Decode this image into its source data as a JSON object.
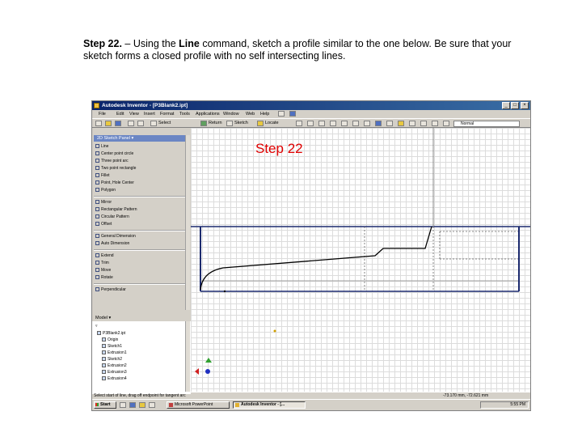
{
  "instruction": {
    "step_label": "Step 22.",
    "dash": "– Using the",
    "command": "Line",
    "text": "command, sketch a profile similar to the one below. Be sure that your sketch forms a closed profile with no self intersecting lines."
  },
  "window": {
    "title": "Autodesk Inventor - [P3Blank2.ipt]",
    "buttons": [
      "_",
      "□",
      "×"
    ]
  },
  "menu": [
    "File",
    "Edit",
    "View",
    "Insert",
    "Format",
    "Tools",
    "Applications",
    "Window",
    "Web",
    "Help"
  ],
  "toolbar": {
    "select": "Select",
    "return": "Return",
    "sketch": "Sketch",
    "locate": "Locate",
    "style": "Normal"
  },
  "sketch_panel": {
    "header": "2D Sketch Panel ▾",
    "groups": [
      [
        "Line",
        "Center point circle",
        "Three point arc",
        "Two point rectangle",
        "Fillet",
        "Point, Hole Center",
        "Polygon"
      ],
      [
        "Mirror",
        "Rectangular Pattern",
        "Circular Pattern",
        "Offset"
      ],
      [
        "General Dimension",
        "Auto Dimension"
      ],
      [
        "Extend",
        "Trim",
        "Move",
        "Rotate"
      ],
      [
        "Perpendicular"
      ]
    ]
  },
  "browser": {
    "header": "Model ▾",
    "items": [
      "P3Blank2.ipt",
      "Origin",
      "Sketch1",
      "Extrusion1",
      "Sketch2",
      "Extrusion2",
      "Extrusion3",
      "Extrusion4"
    ]
  },
  "canvas": {
    "label": "Step 22",
    "label_color": "#e00000"
  },
  "status": {
    "hint": "Select start of line, drag off endpoint for tangent arc",
    "coords": "-73.170 mm, -72.621 mm"
  },
  "taskbar": {
    "start": "Start",
    "tasks": [
      "Microsoft PowerPoint",
      "Autodesk Inventor - [..."
    ],
    "clock": "5:55 PM"
  },
  "colors": {
    "title_bar": "#0a246a",
    "panel_header": "#6b86c4",
    "part_edge": "#1c2a6e",
    "sketch_line": "#000000"
  }
}
